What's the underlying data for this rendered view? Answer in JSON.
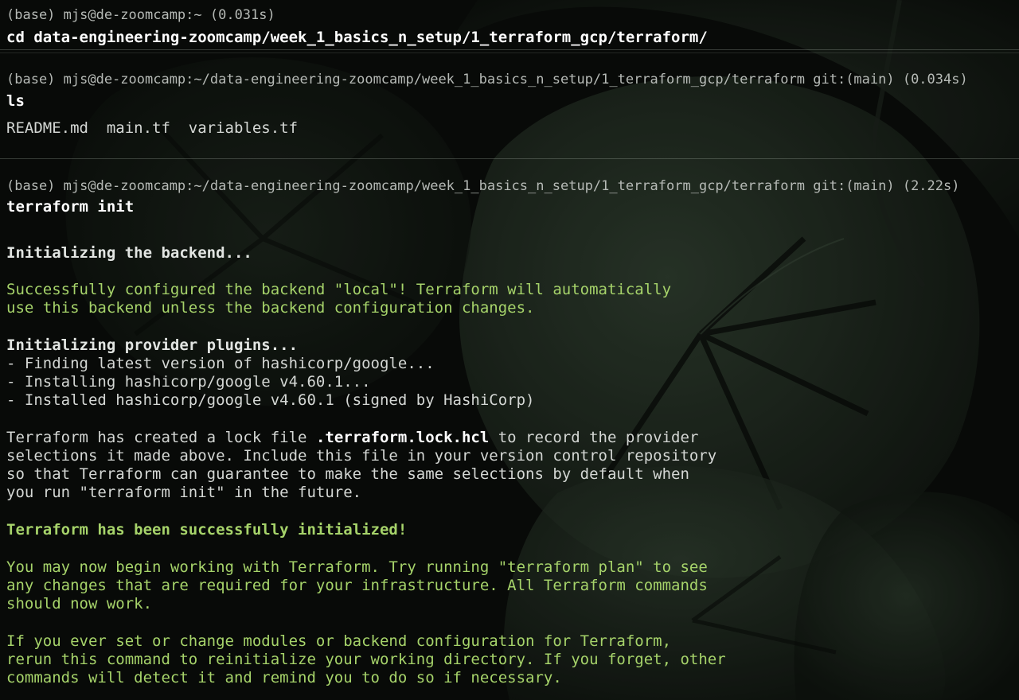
{
  "theme": {
    "background": "#0b0e0b",
    "prompt_color": "#b6bab6",
    "command_color": "#ffffff",
    "output_color": "#d4d7d4",
    "success_color": "#a6d36a"
  },
  "blocks": [
    {
      "prompt": "(base) mjs@de-zoomcamp:~ (0.031s)",
      "command": "cd data-engineering-zoomcamp/week_1_basics_n_setup/1_terraform_gcp/terraform/"
    },
    {
      "prompt": "(base) mjs@de-zoomcamp:~/data-engineering-zoomcamp/week_1_basics_n_setup/1_terraform_gcp/terraform git:(main) (0.034s)",
      "command": "ls",
      "output": "README.md  main.tf  variables.tf"
    },
    {
      "prompt": "(base) mjs@de-zoomcamp:~/data-engineering-zoomcamp/week_1_basics_n_setup/1_terraform_gcp/terraform git:(main) (2.22s)",
      "command": "terraform init",
      "output": {
        "backend_heading": "Initializing the backend...",
        "backend_msg_1": "Successfully configured the backend \"local\"! Terraform will automatically",
        "backend_msg_2": "use this backend unless the backend configuration changes.",
        "plugins_heading": "Initializing provider plugins...",
        "plugin_1": "- Finding latest version of hashicorp/google...",
        "plugin_2": "- Installing hashicorp/google v4.60.1...",
        "plugin_3": "- Installed hashicorp/google v4.60.1 (signed by HashiCorp)",
        "lock_pre": "Terraform has created a lock file ",
        "lock_file": ".terraform.lock.hcl",
        "lock_post": " to record the provider",
        "lock_2": "selections it made above. Include this file in your version control repository",
        "lock_3": "so that Terraform can guarantee to make the same selections by default when",
        "lock_4": "you run \"terraform init\" in the future.",
        "success": "Terraform has been successfully initialized!",
        "next_1": "You may now begin working with Terraform. Try running \"terraform plan\" to see",
        "next_2": "any changes that are required for your infrastructure. All Terraform commands",
        "next_3": "should now work.",
        "rerun_1": "If you ever set or change modules or backend configuration for Terraform,",
        "rerun_2": "rerun this command to reinitialize your working directory. If you forget, other",
        "rerun_3": "commands will detect it and remind you to do so if necessary."
      }
    }
  ]
}
